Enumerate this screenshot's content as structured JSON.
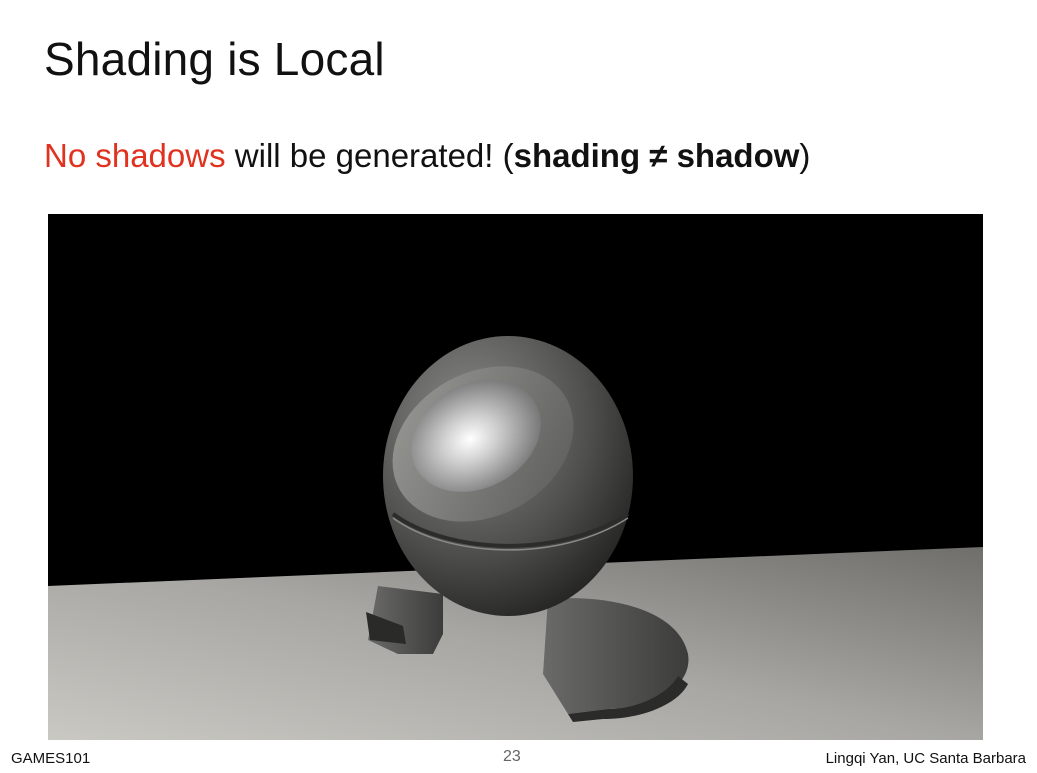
{
  "slide": {
    "title": "Shading is Local",
    "subtitle": {
      "highlight": "No shadows",
      "middle": " will be generated! (",
      "bold": "shading ≠ shadow",
      "end": ")"
    }
  },
  "footer": {
    "course": "GAMES101",
    "page_number": "23",
    "author": "Lingqi Yan, UC Santa Barbara"
  },
  "colors": {
    "highlight": "#e0321f",
    "background": "#ffffff",
    "render_background": "#000000"
  }
}
